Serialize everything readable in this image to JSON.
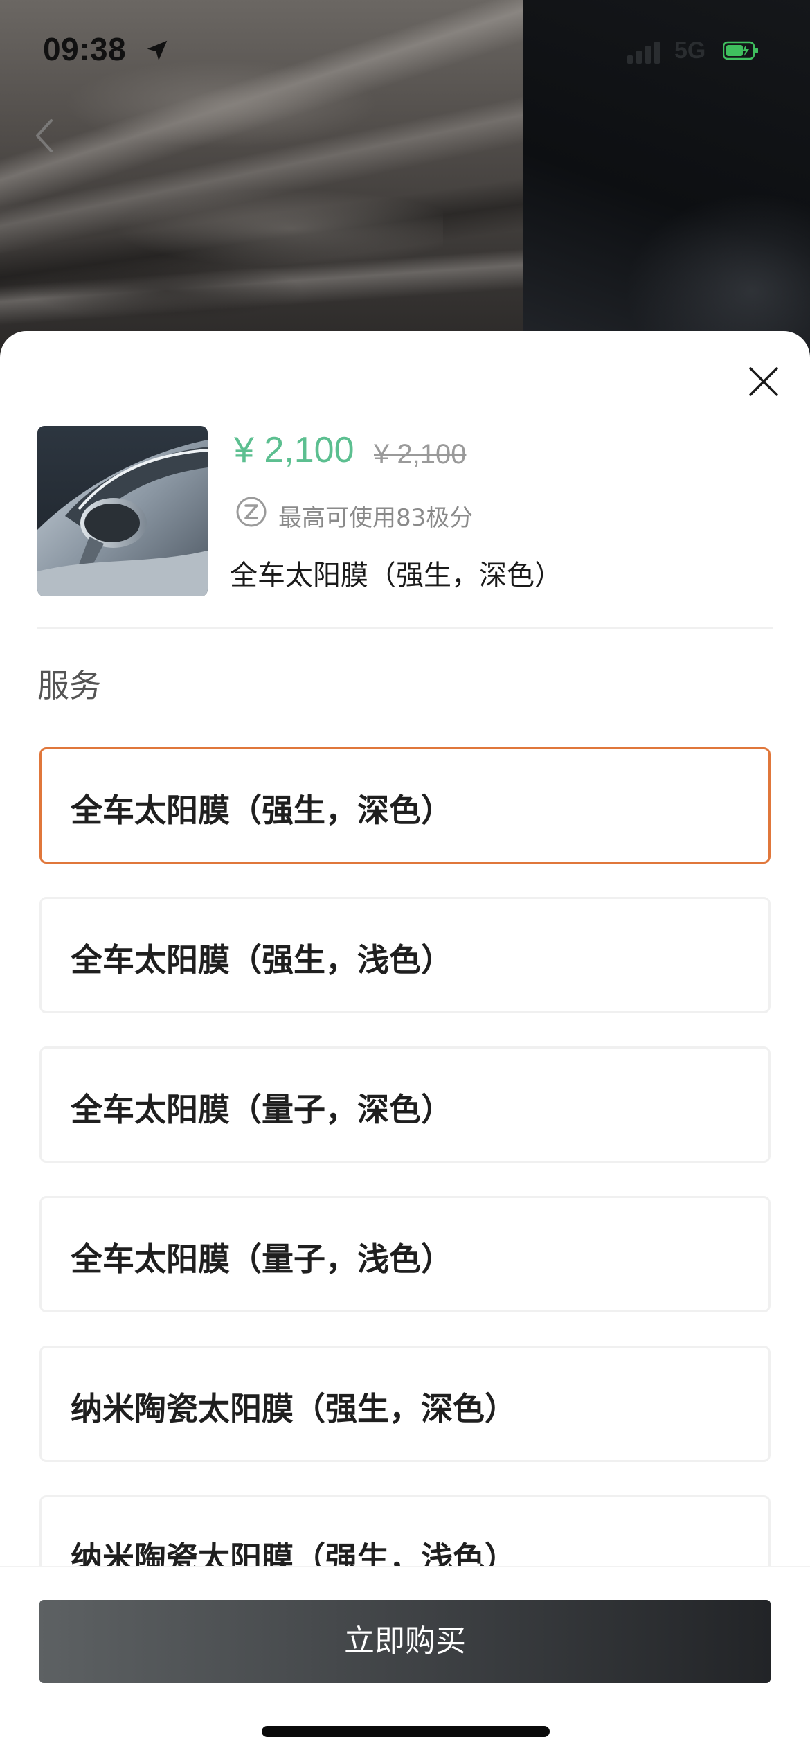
{
  "status_bar": {
    "time": "09:38",
    "network": "5G"
  },
  "icons": {
    "location": "location-arrow-icon",
    "signal": "cellular-signal-icon",
    "battery": "battery-charging-icon",
    "back": "chevron-left-icon",
    "close": "close-icon",
    "points": "z-points-icon"
  },
  "product": {
    "price": "¥ 2,100",
    "original_price": "¥ 2,100",
    "points_note": "最高可使用83极分",
    "name": "全车太阳膜（强生，深色）"
  },
  "section": {
    "title": "服务"
  },
  "options": [
    {
      "label": "全车太阳膜（强生，深色）",
      "selected": true
    },
    {
      "label": "全车太阳膜（强生，浅色）",
      "selected": false
    },
    {
      "label": "全车太阳膜（量子，深色）",
      "selected": false
    },
    {
      "label": "全车太阳膜（量子，浅色）",
      "selected": false
    },
    {
      "label": "纳米陶瓷太阳膜（强生，深色）",
      "selected": false
    },
    {
      "label": "纳米陶瓷太阳膜（强生，浅色）",
      "selected": false
    }
  ],
  "actions": {
    "buy_label": "立即购买"
  },
  "colors": {
    "price": "#5cbf90",
    "selected_border": "#e0773b",
    "buy_button_dark": "#222427"
  }
}
